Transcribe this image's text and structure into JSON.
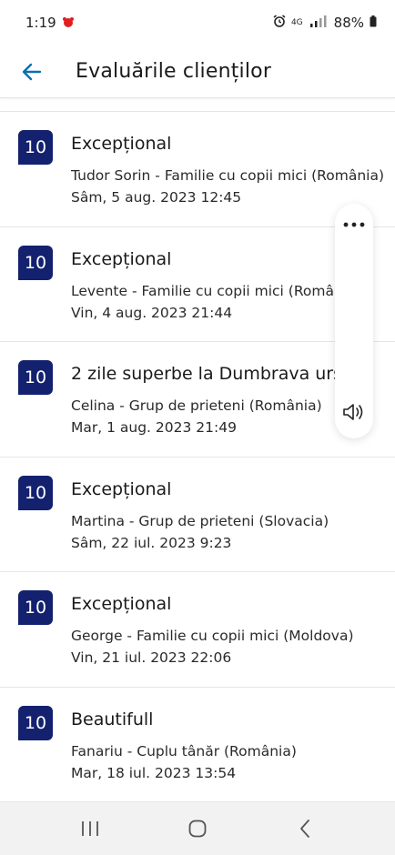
{
  "status_bar": {
    "time": "1:19",
    "network": "4G",
    "battery": "88%"
  },
  "header": {
    "title": "Evaluările clienților"
  },
  "colors": {
    "badge_bg": "#13216e",
    "accent": "#0a6fb5"
  },
  "reviews": [
    {
      "score": "10",
      "title": "Excepțional",
      "author": "Tudor Sorin - Familie cu copii mici (România)",
      "date": "Sâm, 5 aug. 2023 12:45"
    },
    {
      "score": "10",
      "title": "Excepțional",
      "author": "Levente - Familie cu copii mici (România)",
      "date": "Vin, 4 aug. 2023 21:44"
    },
    {
      "score": "10",
      "title": "2 zile superbe la Dumbrava ursului",
      "author": "Celina - Grup de prieteni (România)",
      "date": "Mar, 1 aug. 2023 21:49"
    },
    {
      "score": "10",
      "title": "Excepțional",
      "author": "Martina - Grup de prieteni (Slovacia)",
      "date": "Sâm, 22 iul. 2023 9:23"
    },
    {
      "score": "10",
      "title": "Excepțional",
      "author": "George - Familie cu copii mici (Moldova)",
      "date": "Vin, 21 iul. 2023 22:06"
    },
    {
      "score": "10",
      "title": "Beautifull",
      "author": "Fanariu - Cuplu tânăr (România)",
      "date": "Mar, 18 iul. 2023 13:54"
    }
  ],
  "icons": {
    "back": "arrow-left-icon",
    "more": "more-horizontal-icon",
    "volume": "volume-icon",
    "recents": "recents-icon",
    "home": "home-icon",
    "nav_back": "chevron-left-icon"
  }
}
